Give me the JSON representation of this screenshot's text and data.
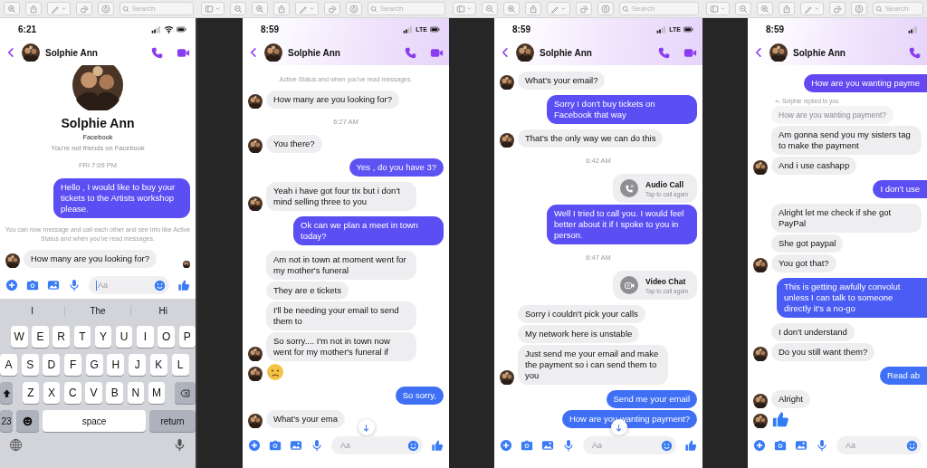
{
  "screenshots": [
    {
      "toolbar": {
        "search_placeholder": "Search"
      },
      "phone": {
        "status": {
          "time": "6:21"
        },
        "header": {
          "name": "Solphie Ann"
        },
        "messages": [
          {
            "kind": "profile",
            "name": "Solphie Ann",
            "source": "Facebook",
            "relation": "You're not friends on Facebook"
          },
          {
            "kind": "time",
            "text": "FRI 7:09 PM"
          },
          {
            "kind": "out",
            "text": "Hello , I would like to buy your tickets to the Artists workshop please.",
            "color": "#5b4ef3"
          },
          {
            "kind": "notice",
            "text": "You can now message and call each other and see info like Active Status and when you've read messages."
          },
          {
            "kind": "in",
            "text": "How many are you looking for?",
            "avatar": true,
            "seen": true
          }
        ],
        "composer": {
          "placeholder": "Aa",
          "focused": true
        },
        "scroll_button": false,
        "keyboard": {
          "suggestions": [
            "I",
            "The",
            "Hi"
          ],
          "rows": [
            [
              "W",
              "E",
              "R",
              "T",
              "Y",
              "U",
              "I",
              "O",
              "P"
            ],
            [
              "A",
              "S",
              "D",
              "F",
              "G",
              "H",
              "J",
              "K",
              "L"
            ],
            [
              "Z",
              "X",
              "C",
              "V",
              "B",
              "N",
              "M"
            ]
          ],
          "numbers_key": "23",
          "space_key": "space",
          "return_key": "return"
        }
      }
    },
    {
      "toolbar": {
        "search_placeholder": "Search"
      },
      "phone": {
        "status": {
          "time": "8:59",
          "network": "LTE"
        },
        "header": {
          "name": "Solphie Ann"
        },
        "messages": [
          {
            "kind": "notice",
            "text": "Active Status and when you've read messages."
          },
          {
            "kind": "in",
            "text": "How many are you looking for?",
            "avatar": true
          },
          {
            "kind": "time",
            "text": "6:27 AM"
          },
          {
            "kind": "in",
            "text": "You there?",
            "avatar": true
          },
          {
            "kind": "out",
            "text": "Yes , do you have 3?",
            "color": "#5d52f2"
          },
          {
            "kind": "in",
            "text": "Yeah i have got four tix but i don't mind selling three to you",
            "avatar": true
          },
          {
            "kind": "out",
            "text": "Ok can we plan a meet in town today?",
            "color": "#5b4ef3"
          },
          {
            "kind": "in",
            "text": "Am not in town at moment went for my mother's funeral",
            "avatar": false
          },
          {
            "kind": "in",
            "text": "They are e tickets",
            "avatar": false
          },
          {
            "kind": "in",
            "text": "I'll be needing your email to send them to",
            "avatar": false
          },
          {
            "kind": "in",
            "text": "So sorry.... I'm not in town now went for my mother's funeral if",
            "avatar": true
          },
          {
            "kind": "emoji",
            "avatar": true
          },
          {
            "kind": "out",
            "text": "So sorry,",
            "color": "#3f6ff5"
          },
          {
            "kind": "in",
            "text": "What's your ema",
            "avatar": true
          }
        ],
        "composer": {
          "placeholder": "Aa",
          "focused": false
        },
        "scroll_button": true
      }
    },
    {
      "toolbar": {
        "search_placeholder": "Search"
      },
      "phone": {
        "status": {
          "time": "8:59",
          "network": "LTE"
        },
        "header": {
          "name": "Solphie Ann"
        },
        "messages": [
          {
            "kind": "in",
            "text": "What's your email?",
            "avatar": true
          },
          {
            "kind": "out",
            "text": "Sorry I don't buy tickets on Facebook that way",
            "color": "#5b4ef3"
          },
          {
            "kind": "in",
            "text": "That's the only way we can do this",
            "avatar": true
          },
          {
            "kind": "time",
            "text": "6:42 AM"
          },
          {
            "kind": "audio_call",
            "title": "Audio Call",
            "subtitle": "Tap to call again"
          },
          {
            "kind": "out",
            "text": "Well I tried to call you. I would feel better about it if I spoke to you in person.",
            "color": "#5b4ef3"
          },
          {
            "kind": "time",
            "text": "6:47 AM"
          },
          {
            "kind": "video_call",
            "title": "Video Chat",
            "subtitle": "Tap to call again"
          },
          {
            "kind": "in",
            "text": "Sorry i couldn't pick your calls",
            "avatar": false
          },
          {
            "kind": "in",
            "text": "My network here is unstable",
            "avatar": false
          },
          {
            "kind": "in",
            "text": "Just send me your email and make the payment so i can send them to you",
            "avatar": true
          },
          {
            "kind": "out",
            "text": "Send me your email",
            "color": "#3f6ff5"
          },
          {
            "kind": "out",
            "text": "How are you wanting payment?",
            "color": "#3f6ff5"
          }
        ],
        "composer": {
          "placeholder": "Aa",
          "focused": false
        },
        "scroll_button": true
      }
    },
    {
      "toolbar": {
        "search_placeholder": "Search"
      },
      "phone": {
        "status": {
          "time": "8:59"
        },
        "header": {
          "name": "Solphie Ann"
        },
        "messages": [
          {
            "kind": "out",
            "text": "How are you wanting payme",
            "color": "#6447f1"
          },
          {
            "kind": "reply_note",
            "text": "Solphie replied to you"
          },
          {
            "kind": "quoted",
            "text": "How are you wanting payment?"
          },
          {
            "kind": "in",
            "text": "Am gonna send you my sisters tag to make the payment",
            "avatar": false
          },
          {
            "kind": "in",
            "text": "And i use cashapp",
            "avatar": true
          },
          {
            "kind": "out",
            "text": "I don't use",
            "color": "#5b4ef3"
          },
          {
            "kind": "in",
            "text": "Alright let me check if she got PayPal",
            "avatar": false
          },
          {
            "kind": "in",
            "text": "She got paypal",
            "avatar": false
          },
          {
            "kind": "in",
            "text": "You got that?",
            "avatar": true
          },
          {
            "kind": "out",
            "text": "This is getting awfully convolut unless I can talk to someone directly it's a no-go",
            "color": "#4a5cf3"
          },
          {
            "kind": "in",
            "text": "I don't understand",
            "avatar": false
          },
          {
            "kind": "in",
            "text": "Do you still want them?",
            "avatar": true
          },
          {
            "kind": "out",
            "text": "Read ab",
            "color": "#3f6ff5"
          },
          {
            "kind": "in",
            "text": "Alright",
            "avatar": true
          },
          {
            "kind": "like",
            "avatar": true
          }
        ],
        "composer": {
          "placeholder": "Aa",
          "focused": false
        },
        "scroll_button": false
      }
    }
  ]
}
